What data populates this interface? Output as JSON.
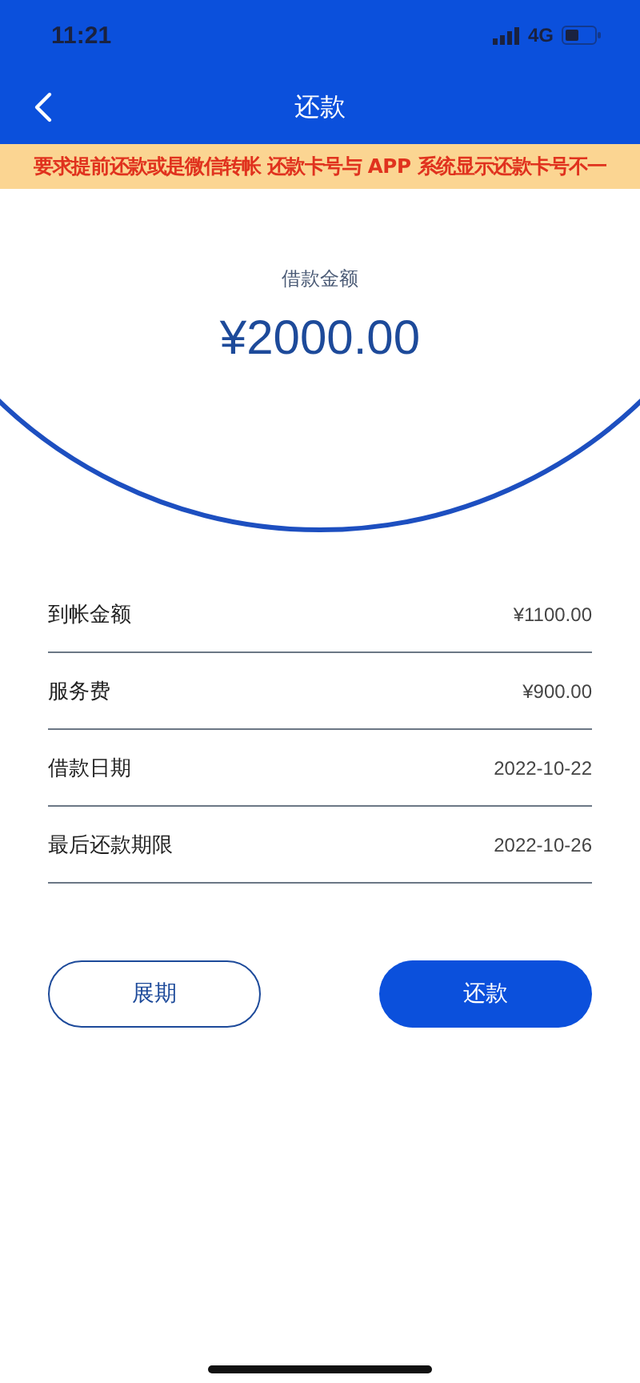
{
  "status_bar": {
    "time": "11:21",
    "network": "4G"
  },
  "nav": {
    "title": "还款"
  },
  "notice": {
    "text": "要求提前还款或是微信转帐 还款卡号与 APP 系统显示还款卡号不一"
  },
  "loan": {
    "label": "借款金额",
    "amount": "¥2000.00"
  },
  "details": [
    {
      "label": "到帐金额",
      "value": "¥1100.00"
    },
    {
      "label": "服务费",
      "value": "¥900.00"
    },
    {
      "label": "借款日期",
      "value": "2022-10-22"
    },
    {
      "label": "最后还款期限",
      "value": "2022-10-26"
    }
  ],
  "buttons": [
    {
      "label": "展期",
      "kind": "outline"
    },
    {
      "label": "还款",
      "kind": "primary"
    }
  ]
}
